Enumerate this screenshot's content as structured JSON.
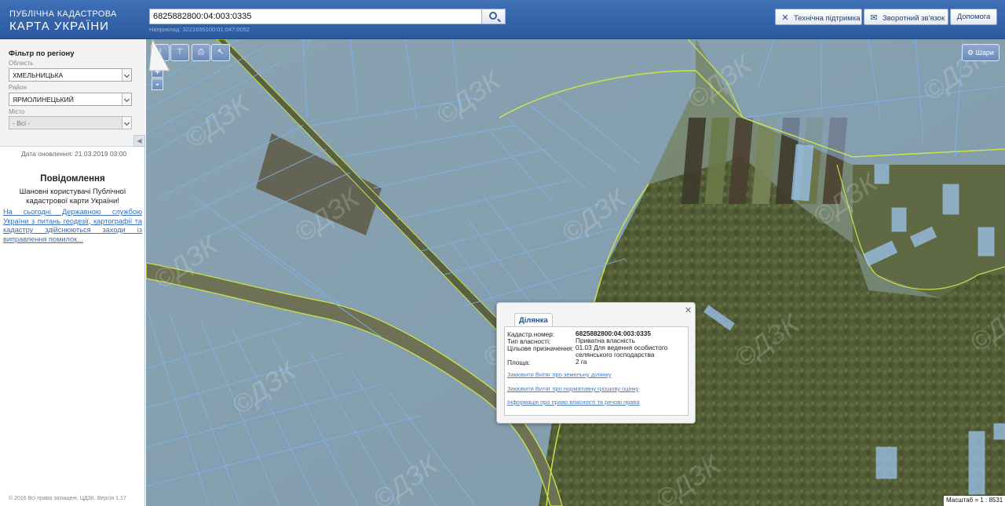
{
  "header": {
    "brand_line1": "ПУБЛІЧНА КАДАСТРОВА",
    "brand_line2": "КАРТА УКРАЇНИ",
    "search_value": "6825882800:04:003:0335",
    "search_example": "Наприклад: 3221655100:01:047:0052",
    "buttons": {
      "support": "Технічна підтримка",
      "feedback": "Зворотний зв'язок",
      "help": "Допомога"
    }
  },
  "sidebar": {
    "filter_title": "Фільтр по регіону",
    "region_label": "Область",
    "region_value": "ХМЕЛЬНИЦЬКА",
    "district_label": "Район",
    "district_value": "ЯРМОЛИНЕЦЬКИЙ",
    "city_label": "Місто",
    "city_value": "- Всі -",
    "update_date": "Дата оновлення: 21.03.2019 03:00",
    "message_title": "Повідомлення",
    "message_text": "Шановні користувачі Публічної кадастрової карти України!",
    "message_link": "На сьогодні Державною службою України з питань геодезії, картографії та кадастру здійснюються заходи із виправлення помилок...",
    "copyright": "© 2016 Всі права захищені, ЦДЗК. Версія 1.17"
  },
  "map": {
    "layers_label": "Шари",
    "scale_text": "Масштаб = 1 : 8531",
    "watermark": "© ДЗК",
    "colors": {
      "parcel_fill": "#8fb3e0",
      "parcel_stroke": "#7fb4f0",
      "boundary": "#c9e24a",
      "forest": "#4f5a36"
    }
  },
  "popup": {
    "tab": "Ділянка",
    "rows": [
      {
        "key": "Кадастр.номер:",
        "value": "6825882800:04:003:0335"
      },
      {
        "key": "Тип власності:",
        "value": "Приватна власність"
      },
      {
        "key": "Цільове призначення:",
        "value": "01.03 Для ведення особистого селянського господарства"
      },
      {
        "key": "Площа:",
        "value": "2 га"
      }
    ],
    "links": [
      "Замовити Витяг про земельну ділянку",
      "Замовити Витяг про нормативну грошову оцінку",
      "Інформація про право власності та речові права"
    ]
  }
}
